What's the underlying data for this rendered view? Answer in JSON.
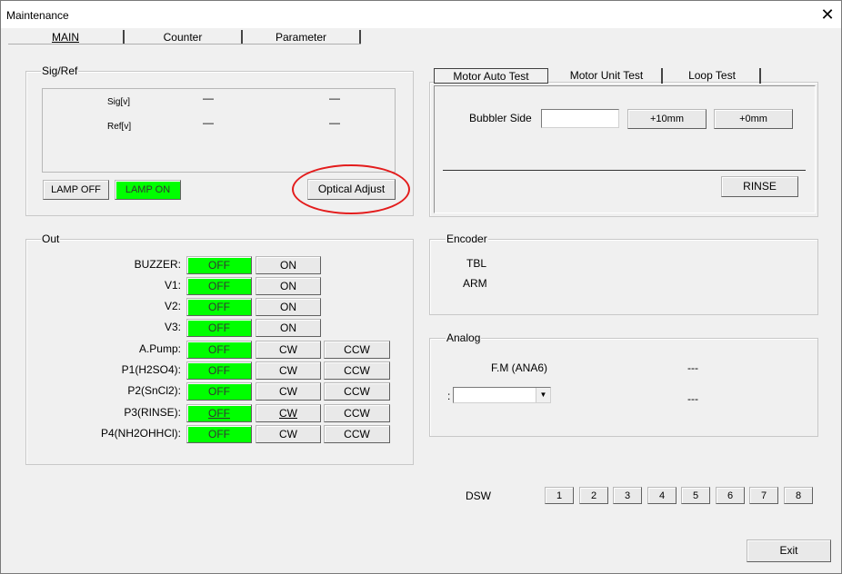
{
  "window": {
    "title": "Maintenance",
    "close_glyph": "✕"
  },
  "tabs": [
    {
      "label": "MAIN"
    },
    {
      "label": "Counter"
    },
    {
      "label": "Parameter"
    }
  ],
  "sigref": {
    "group_label": "Sig/Ref",
    "sig_label": "Sig[v]",
    "ref_label": "Ref[v]",
    "sig_val1": "—",
    "sig_val2": "—",
    "ref_val1": "—",
    "ref_val2": "—",
    "lamp_off": "LAMP OFF",
    "lamp_on": "LAMP ON",
    "optical_adjust": "Optical Adjust"
  },
  "out": {
    "group_label": "Out",
    "rows": [
      {
        "label": "BUZZER:",
        "off": "OFF",
        "b1": "ON"
      },
      {
        "label": "V1:",
        "off": "OFF",
        "b1": "ON"
      },
      {
        "label": "V2:",
        "off": "OFF",
        "b1": "ON"
      },
      {
        "label": "V3:",
        "off": "OFF",
        "b1": "ON"
      },
      {
        "label": "A.Pump:",
        "off": "OFF",
        "b1": "CW",
        "b2": "CCW"
      },
      {
        "label": "P1(H2SO4):",
        "off": "OFF",
        "b1": "CW",
        "b2": "CCW"
      },
      {
        "label": "P2(SnCl2):",
        "off": "OFF",
        "b1": "CW",
        "b2": "CCW"
      },
      {
        "label": "P3(RINSE):",
        "off": "OFF",
        "b1": "CW",
        "b2": "CCW"
      },
      {
        "label": "P4(NH2OHHCl):",
        "off": "OFF",
        "b1": "CW",
        "b2": "CCW"
      }
    ]
  },
  "motor": {
    "tabs": [
      {
        "label": "Motor Auto Test"
      },
      {
        "label": "Motor Unit Test"
      },
      {
        "label": "Loop Test"
      }
    ],
    "bubbler_label": "Bubbler Side",
    "bubbler_value": "",
    "btn_plus10": "+10mm",
    "btn_plus0": "+0mm",
    "rinse": "RINSE"
  },
  "encoder": {
    "group_label": "Encoder",
    "tbl": "TBL",
    "arm": "ARM"
  },
  "analog": {
    "group_label": "Analog",
    "fm_label": "F.M  (ANA6)",
    "fm_value": "---",
    "colon": ":",
    "select_value": "",
    "select_value_display": "---"
  },
  "dsw": {
    "label": "DSW",
    "buttons": [
      "1",
      "2",
      "3",
      "4",
      "5",
      "6",
      "7",
      "8"
    ]
  },
  "exit_label": "Exit",
  "colors": {
    "green": "#00ff00",
    "highlight_oval": "#e31c1c"
  }
}
